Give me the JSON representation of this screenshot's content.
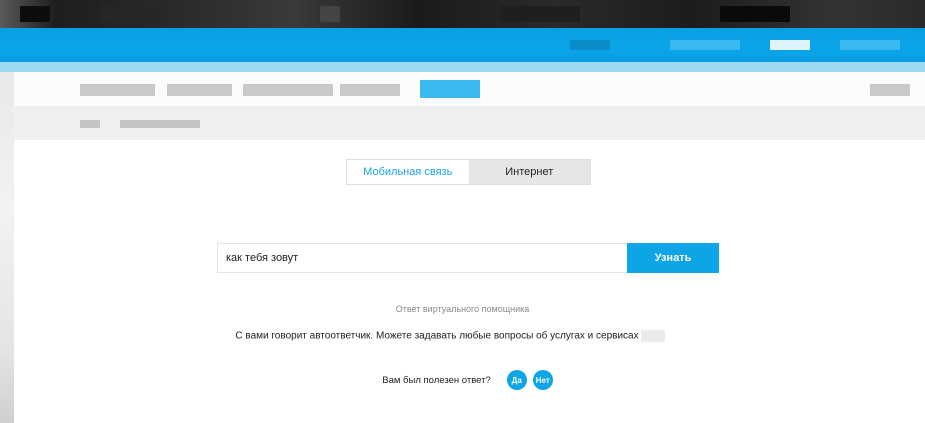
{
  "tabs": [
    {
      "label": "Мобильная связь",
      "active": true
    },
    {
      "label": "Интернет",
      "active": false
    }
  ],
  "search": {
    "value": "как тебя зовут",
    "button_label": "Узнать"
  },
  "assistant": {
    "label": "Ответ виртуального помощника",
    "answer": "С вами говорит автоответчик. Можете задавать любые вопросы об услугах и сервисах"
  },
  "feedback": {
    "question": "Вам был полезен ответ?",
    "yes_label": "Да",
    "no_label": "Нет"
  },
  "colors": {
    "accent": "#0ea5e6",
    "tab_active_text": "#1aa3df"
  }
}
